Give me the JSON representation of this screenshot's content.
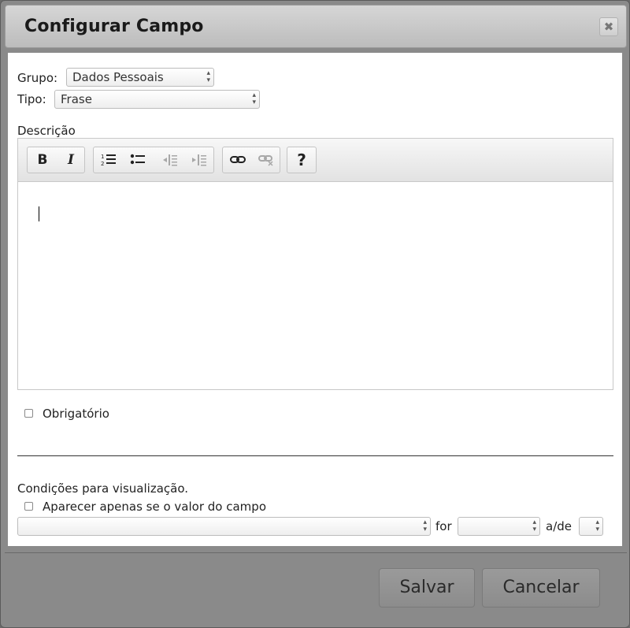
{
  "dialog": {
    "title": "Configurar Campo",
    "close_glyph": "✖"
  },
  "form": {
    "group_label": "Grupo:",
    "group_value": "Dados Pessoais",
    "type_label": "Tipo:",
    "type_value": "Frase",
    "description_label": "Descrição",
    "required_label": "Obrigatório",
    "conditions_label": "Condições para visualização.",
    "appear_label": "Aparecer apenas se o valor do campo",
    "field_value": "",
    "for_label": "for",
    "operator_value": "",
    "of_label": "a/de",
    "target_value": ""
  },
  "toolbar": {
    "bold": "B",
    "italic": "I",
    "help": "?"
  },
  "icons": {
    "bold": "bold-icon",
    "italic": "italic-icon",
    "ordered_list": "ordered-list-icon",
    "unordered_list": "unordered-list-icon",
    "outdent": "outdent-icon",
    "indent": "indent-icon",
    "link": "link-icon",
    "unlink": "unlink-icon",
    "help": "help-icon"
  },
  "buttons": {
    "save": "Salvar",
    "cancel": "Cancelar"
  }
}
